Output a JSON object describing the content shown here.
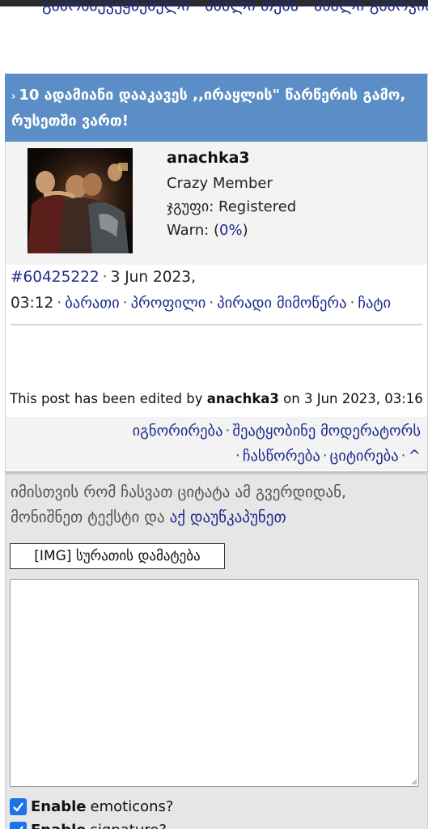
{
  "top_links_cut": "გამოსაქვეყნებელი · ახალი თემა · ახალი გამოკითხვა",
  "topic": {
    "title": "10 ადამიანი დააკავეს ,,ირაყლის\" წარწერის გამო, რუსეთში ვართ!"
  },
  "user": {
    "name": "anachka3",
    "rank": "Crazy Member",
    "group_label": "ჯგუფი:",
    "group": "Registered",
    "warn_label": "Warn:",
    "warn_open": "(",
    "warn_value": "0%",
    "warn_close": ")"
  },
  "post_meta": {
    "post_number": "#60425222",
    "date": "3 Jun 2023, 03:12",
    "link_barati": "ბარათი",
    "link_profile": "პროფილი",
    "link_pm": "პირადი მიმოწერა",
    "link_chat": "ჩატი"
  },
  "edit_note": {
    "prefix": "This post has been edited by",
    "editor": "anachka3",
    "on_text": "on 3 Jun 2023, 03:16"
  },
  "post_actions": {
    "ignore": "იგნორირება",
    "report": "შეატყობინე მოდერატორს",
    "fix": "ჩასწორება",
    "quote": "ციტირება",
    "up": "^"
  },
  "reply": {
    "hint_text": "იმისთვის რომ ჩასვათ ციტატა ამ გვერდიდან, მონიშნეთ ტექსტი და",
    "hint_link": "აქ დაუწკაპუნეთ",
    "img_button": "[IMG] სურათის დამატება",
    "textarea_value": ""
  },
  "options": {
    "emoticons_bold": "Enable",
    "emoticons_rest": "emoticons?",
    "signature_bold": "Enable",
    "signature_rest": "signature?"
  },
  "colors": {
    "header_bg": "#5b8ec6",
    "link": "#1c2a8c",
    "checkbox": "#1a73e8"
  }
}
